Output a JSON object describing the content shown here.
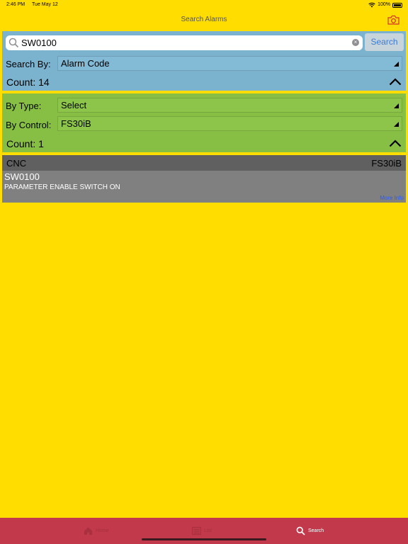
{
  "status_bar": {
    "time": "2:46 PM",
    "date": "Tue May 12",
    "battery": "100%",
    "wifi_icon": "wifi-icon",
    "battery_icon": "battery-icon"
  },
  "nav": {
    "title": "Search Alarms",
    "camera_icon": "camera-icon"
  },
  "search": {
    "value": "SW0100",
    "button_label": "Search",
    "search_by_label": "Search By:",
    "search_by_value": "Alarm Code",
    "count_label": "Count: 14"
  },
  "filters": {
    "type_label": "By Type:",
    "type_value": "Select",
    "control_label": "By Control:",
    "control_value": "FS30iB",
    "count_label": "Count: 1"
  },
  "result": {
    "type": "CNC",
    "control": "FS30iB",
    "code": "SW0100",
    "description": "PARAMETER ENABLE SWITCH ON",
    "more_info": "More Info"
  },
  "tabs": [
    {
      "label": "Home",
      "icon": "home-icon",
      "active": false
    },
    {
      "label": "List",
      "icon": "list-icon",
      "active": false
    },
    {
      "label": "Search",
      "icon": "search-icon",
      "active": true
    }
  ],
  "colors": {
    "background": "#FFDD00",
    "search_panel": "#7BB3CF",
    "filter_panel": "#87BF44",
    "result_card": "#808080",
    "tab_bar": "#C1394B",
    "link": "#2F5BE6"
  }
}
